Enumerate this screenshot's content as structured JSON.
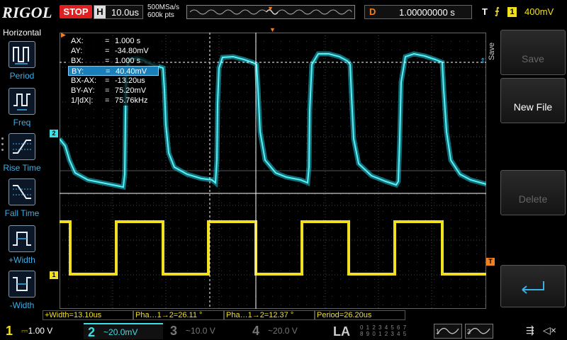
{
  "header": {
    "brand": "RIGOL",
    "run_state": "STOP",
    "timebase_label": "H",
    "timebase_value": "10.0us",
    "sample_rate": "500MSa/s",
    "memory_depth": "600k pts",
    "trigger_delay_label": "D",
    "trigger_delay_value": "1.00000000 s",
    "trigger_label": "T",
    "trigger_edge_icon": "rising-edge-icon",
    "trigger_source": "1",
    "trigger_level": "400mV"
  },
  "sidebar": {
    "title": "Horizontal",
    "items": [
      {
        "label": "Period",
        "icon": "period-icon"
      },
      {
        "label": "Freq",
        "icon": "frequency-icon"
      },
      {
        "label": "Rise Time",
        "icon": "rise-time-icon"
      },
      {
        "label": "Fall Time",
        "icon": "fall-time-icon"
      },
      {
        "label": "+Width",
        "icon": "positive-width-icon"
      },
      {
        "label": "-Width",
        "icon": "negative-width-icon"
      }
    ]
  },
  "cursors": {
    "rows": [
      {
        "name": "AX:",
        "eq": "=",
        "value": "1.000 s"
      },
      {
        "name": "AY:",
        "eq": "=",
        "value": "-34.80mV"
      },
      {
        "name": "BX:",
        "eq": "=",
        "value": "1.000 s"
      },
      {
        "name": "BY:",
        "eq": "=",
        "value": "40.40mV"
      },
      {
        "name": "BX-AX:",
        "eq": "=",
        "value": "-13.20us"
      },
      {
        "name": "BY-AY:",
        "eq": "=",
        "value": "75.20mV"
      },
      {
        "name": "1/|dX|:",
        "eq": "=",
        "value": "75.76kHz"
      }
    ],
    "selected_index": 3
  },
  "channel_markers": {
    "ch1": "1",
    "ch2": "2",
    "trigger": "T"
  },
  "right_menu": {
    "side_label": "Save",
    "buttons": [
      {
        "label": "Save",
        "enabled": false
      },
      {
        "label": "New File",
        "enabled": true
      },
      {
        "label": "Delete",
        "enabled": false
      },
      {
        "label": "",
        "icon": "return-arrow-icon"
      }
    ]
  },
  "measurements": [
    {
      "text": "+Width=13.10us"
    },
    {
      "text": "Pha…1→2=26.11 °"
    },
    {
      "text": "Pha…1→2=12.37 °"
    },
    {
      "text": "Period=26.20us"
    }
  ],
  "bottom": {
    "channels": [
      {
        "num": "1",
        "coupling": "⎓",
        "scale": "1.00 V",
        "color": "#f0e020",
        "active": true
      },
      {
        "num": "2",
        "coupling": "~",
        "scale": "20.0mV",
        "color": "#3ae0e8",
        "active": true
      },
      {
        "num": "3",
        "coupling": "~",
        "scale": "10.0 V",
        "color": "#777777",
        "active": false
      },
      {
        "num": "4",
        "coupling": "~",
        "scale": "20.0 V",
        "color": "#777777",
        "active": false
      }
    ],
    "la_label": "LA",
    "la_digits_top": "0 1 2 3  4 5 6 7",
    "la_digits_bottom": "8 9 0 1  2 3 4 5",
    "gen1": "1",
    "gen2": "2"
  },
  "colors": {
    "ch1": "#f0e020",
    "ch2": "#3ae0e8",
    "trigger": "#f08020",
    "accent": "#1a7fb8"
  }
}
